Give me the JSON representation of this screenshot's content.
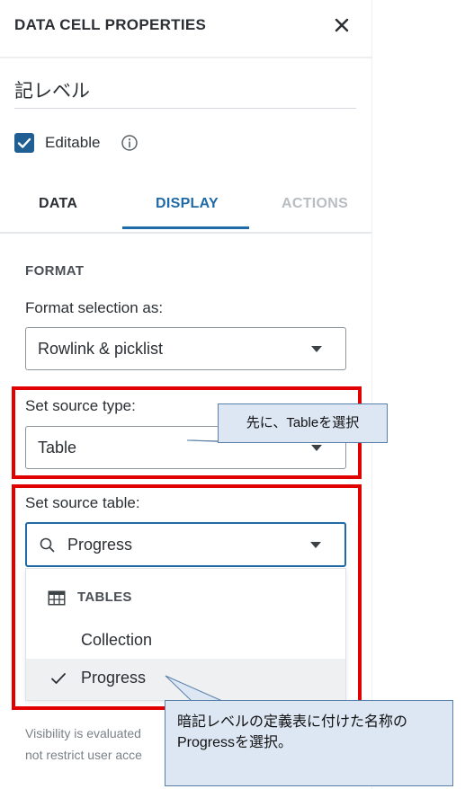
{
  "panel": {
    "title": "DATA CELL PROPERTIES",
    "name_value": "記レベル",
    "editable": {
      "label": "Editable",
      "checked": true
    },
    "tabs": [
      {
        "label": "DATA",
        "state": "normal"
      },
      {
        "label": "DISPLAY",
        "state": "active"
      },
      {
        "label": "ACTIONS",
        "state": "disabled"
      }
    ],
    "format": {
      "section_title": "FORMAT",
      "format_selection_label": "Format selection as:",
      "format_selection_value": "Rowlink & picklist",
      "source_type_label": "Set source type:",
      "source_type_value": "Table",
      "source_table_label": "Set source table:",
      "source_table_search_value": "Progress"
    },
    "dropdown": {
      "group_header": "TABLES",
      "items": [
        {
          "label": "Collection",
          "selected": false
        },
        {
          "label": "Progress",
          "selected": true
        }
      ]
    },
    "visibility_note": "Visibility is evaluated\nnot restrict user acce"
  },
  "annotations": {
    "callout_1": "先に、Tableを選択",
    "callout_2": "暗記レベルの定義表に付けた名称の\nProgressを選択。"
  },
  "colors": {
    "accent": "#1f6aa8",
    "checkbox": "#1f5f94",
    "highlight_box": "#e00000",
    "callout_fill": "#dde7f4",
    "callout_border": "#5a7fa8"
  },
  "icons": [
    "close-icon",
    "info-icon",
    "chevron-down-icon",
    "search-icon",
    "table-icon",
    "checkmark-icon"
  ]
}
